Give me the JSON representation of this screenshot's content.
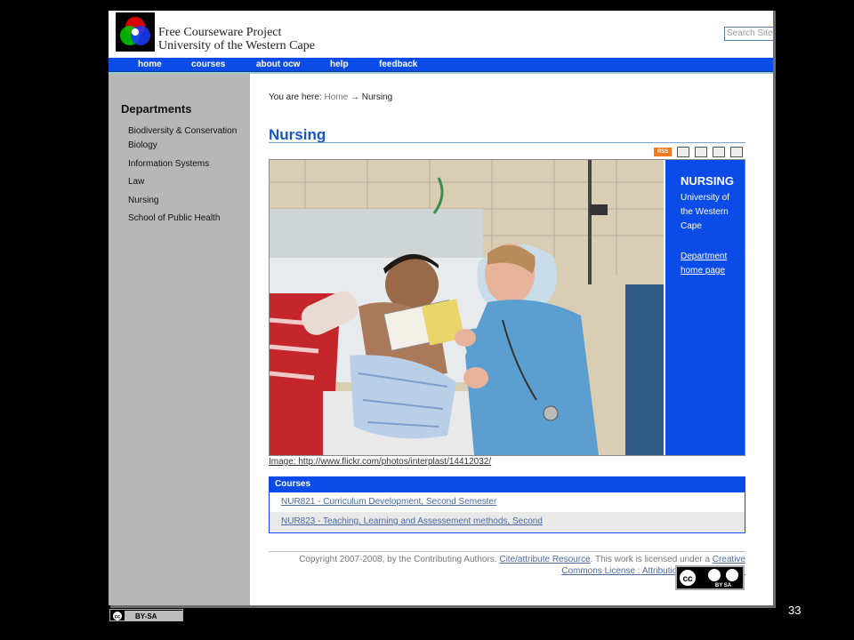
{
  "header": {
    "site_name_line1": "Free Courseware Project",
    "site_name_line2": "University of the Western Cape",
    "search_placeholder": "Search Site"
  },
  "nav": {
    "items": [
      "home",
      "courses",
      "about ocw",
      "help",
      "feedback"
    ]
  },
  "sidebar": {
    "heading": "Departments",
    "items": [
      "Biodiversity & Conservation Biology",
      "Information Systems",
      "Law",
      "Nursing",
      "School of Public Health"
    ]
  },
  "breadcrumb": {
    "prefix": "You are here:",
    "home": "Home",
    "arrow": "→",
    "current": "Nursing"
  },
  "page": {
    "title": "Nursing",
    "rss_label": "RSS"
  },
  "info_box": {
    "title": "NURSING",
    "subtitle": "University of the Western Cape",
    "link": "Department home page"
  },
  "image_credit": "Image: http://www.flickr.com/photos/interplast/14412032/",
  "courses": {
    "heading": "Courses",
    "items": [
      "NUR821 - Curriculum Development, Second Semester",
      "NUR823 - Teaching, Learning and Assessement methods, Second"
    ]
  },
  "footer": {
    "text1": "Copyright 2007-2008, by the Contributing Authors.",
    "cite_link": "Cite/attribute Resource",
    "text2": ". This work is licensed under a",
    "license_link_a": "Creative",
    "license_link_b": "Commons License : Attribution-ShareAlike 3.0.",
    "badge_text": "BY SA"
  },
  "slide": {
    "cc_label": "BY-SA",
    "number": "33"
  },
  "colors": {
    "brand_blue": "#0b4ce8",
    "sidebar_gray": "#b7b7b7",
    "slide_bg": "#000000"
  }
}
